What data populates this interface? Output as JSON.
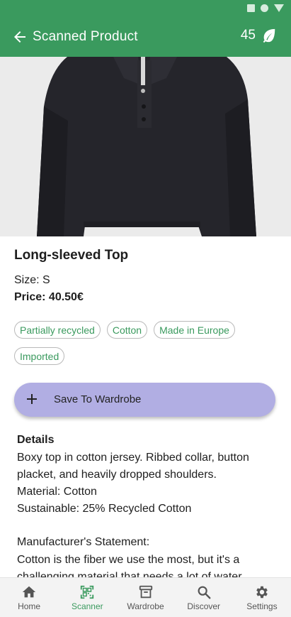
{
  "colors": {
    "primary": "#3a9a5e",
    "chip_text": "#3a9a5e",
    "save_button": "#b1aee3",
    "image_background": "#ebebeb",
    "garment": "#25252b"
  },
  "app_bar": {
    "back_icon": "arrow-left-icon",
    "title": "Scanned Product",
    "score": "45",
    "score_icon": "leaf-icon"
  },
  "product": {
    "image_description_icon": "product-photo",
    "name": "Long-sleeved Top",
    "size": "Size: S",
    "price": "Price: 40.50€",
    "tags": [
      "Partially recycled",
      "Cotton",
      "Made in Europe",
      "Imported"
    ]
  },
  "save_button": {
    "icon": "plus-icon",
    "label": "Save To Wardrobe"
  },
  "details": {
    "title": "Details",
    "lines": [
      "Boxy top in cotton jersey. Ribbed collar, button",
      "placket, and heavily dropped shoulders.",
      "Material: Cotton",
      "Sustainable: 25% Recycled Cotton"
    ]
  },
  "manufacturer": {
    "title": "Manufacturer's Statement:",
    "lines": [
      "Cotton is the fiber we use the most, but it's a",
      "challenging material that needs a lot of water"
    ]
  },
  "bottom_nav": {
    "active": "Scanner",
    "items": [
      {
        "label": "Home",
        "icon": "home-icon"
      },
      {
        "label": "Scanner",
        "icon": "qr-scanner-icon"
      },
      {
        "label": "Wardrobe",
        "icon": "archive-icon"
      },
      {
        "label": "Discover",
        "icon": "search-icon"
      },
      {
        "label": "Settings",
        "icon": "gear-icon"
      }
    ]
  }
}
